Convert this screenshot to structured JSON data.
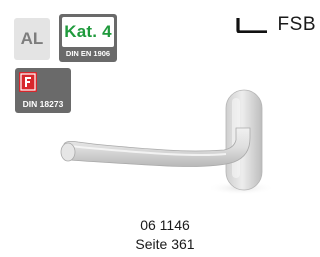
{
  "badges": {
    "material": {
      "label": "AL"
    },
    "category": {
      "label": "Kat. 4",
      "norm": "DIN EN 1906",
      "accent": "#1f9a3c"
    },
    "fire": {
      "icon": "fire-f-icon",
      "norm": "DIN 18273",
      "accent": "#d8262b"
    }
  },
  "brand": {
    "name": "FSB",
    "icon": "fsb-logo-mark-icon"
  },
  "product": {
    "image": "lever-handle-image",
    "article_number": "06 1146",
    "page_ref": "Seite 361"
  }
}
